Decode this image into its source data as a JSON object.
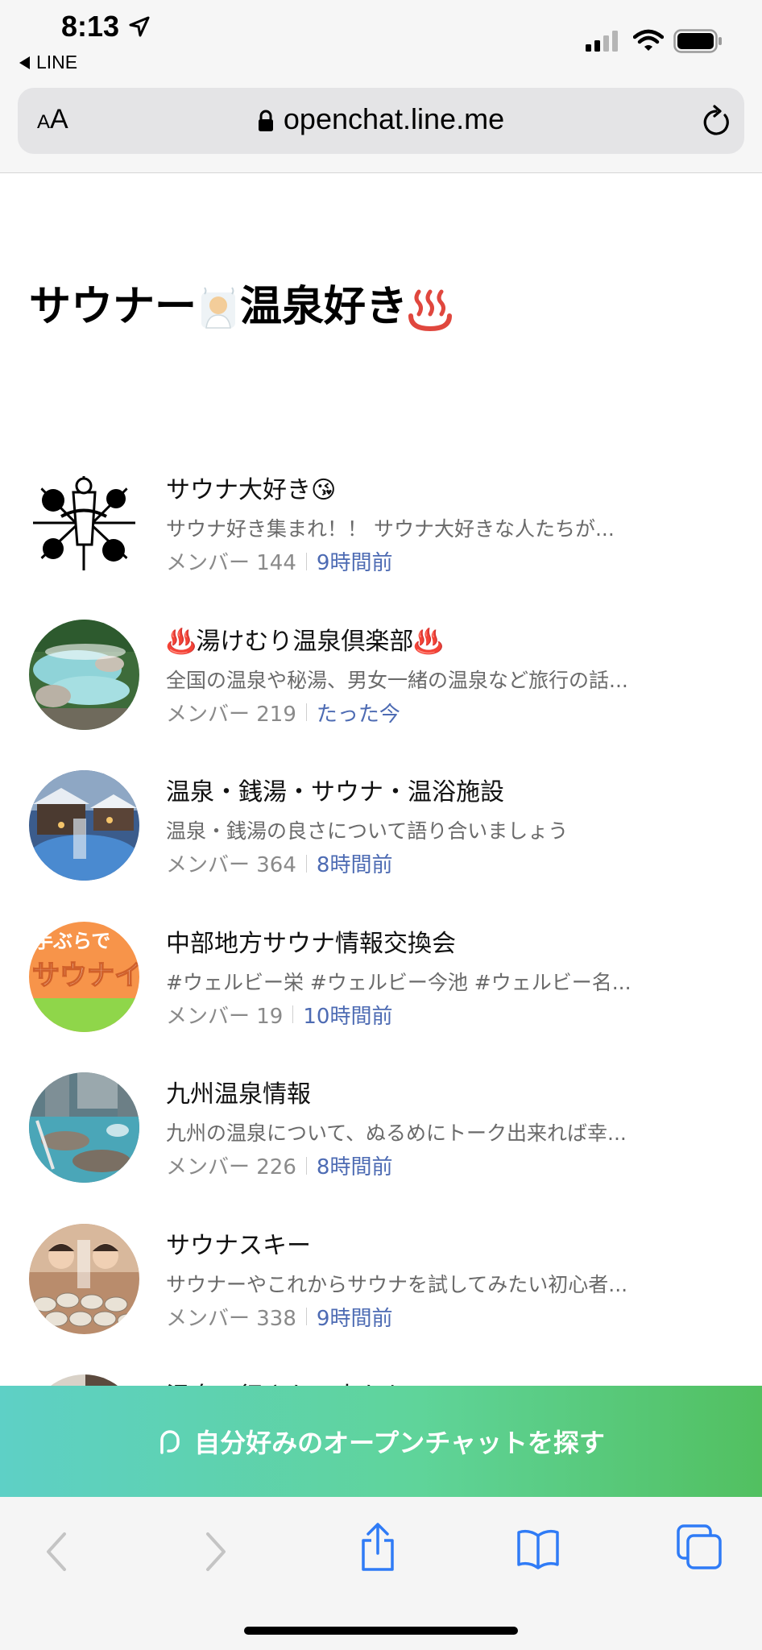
{
  "status_bar": {
    "time": "8:13",
    "back_app": "LINE"
  },
  "browser": {
    "text_size_small": "A",
    "text_size_big": "A",
    "url": "openchat.line.me"
  },
  "page": {
    "title": "サウナー",
    "title_emoji_1": "🧖‍♂️",
    "title_rest": "温泉好き"
  },
  "chats": [
    {
      "title": "サウナ大好き😘",
      "desc": "サウナ好き集まれ！！ サウナ大好きな人たちが...",
      "members": "メンバー 144",
      "time": "9時間前",
      "avatar": "manga-art"
    },
    {
      "title": "♨️湯けむり温泉倶楽部♨️",
      "desc": "全国の温泉や秘湯、男女一緒の温泉など旅行の話...",
      "members": "メンバー 219",
      "time": "たった今",
      "avatar": "hot-spring-rocks"
    },
    {
      "title": "温泉・銭湯・サウナ・温浴施設",
      "desc": "温泉・銭湯の良さについて語り合いましょう",
      "members": "メンバー 364",
      "time": "8時間前",
      "avatar": "snowy-onsen"
    },
    {
      "title": "中部地方サウナ情報交換会",
      "desc": "#ウェルビー栄 #ウェルビー今池 #ウェルビー名...",
      "members": "メンバー 19",
      "time": "10時間前",
      "avatar": "sauna-text-banner"
    },
    {
      "title": "九州温泉情報",
      "desc": "九州の温泉について、ぬるめにトーク出来れば幸...",
      "members": "メンバー 226",
      "time": "8時間前",
      "avatar": "resort-pool"
    },
    {
      "title": "サウナスキー",
      "desc": "サウナーやこれからサウナを試してみたい初心者...",
      "members": "メンバー 338",
      "time": "9時間前",
      "avatar": "sauna-stones"
    },
    {
      "title": "温泉に行きたい人たち",
      "desc": "",
      "members": "",
      "time": "",
      "avatar": "partial"
    }
  ],
  "cta": {
    "label": "自分好みのオープンチャットを探す"
  },
  "colors": {
    "accent_time": "#4d6bb3",
    "cta_start": "#5ed0c6",
    "cta_end": "#52c060",
    "toolbar_icon": "#2f7bf6"
  }
}
